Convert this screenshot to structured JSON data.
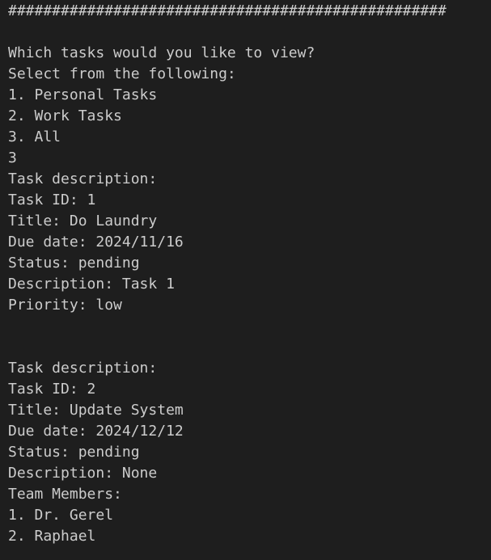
{
  "terminal": {
    "lines": [
      "##################################################",
      "",
      "Which tasks would you like to view?",
      "Select from the following:",
      "1. Personal Tasks",
      "2. Work Tasks",
      "3. All",
      "3",
      "Task description:",
      "Task ID: 1",
      "Title: Do Laundry",
      "Due date: 2024/11/16",
      "Status: pending",
      "Description: Task 1",
      "Priority: low",
      "",
      "",
      "Task description:",
      "Task ID: 2",
      "Title: Update System",
      "Due date: 2024/12/12",
      "Status: pending",
      "Description: None",
      "Team Members:",
      "1. Dr. Gerel",
      "2. Raphael"
    ]
  }
}
